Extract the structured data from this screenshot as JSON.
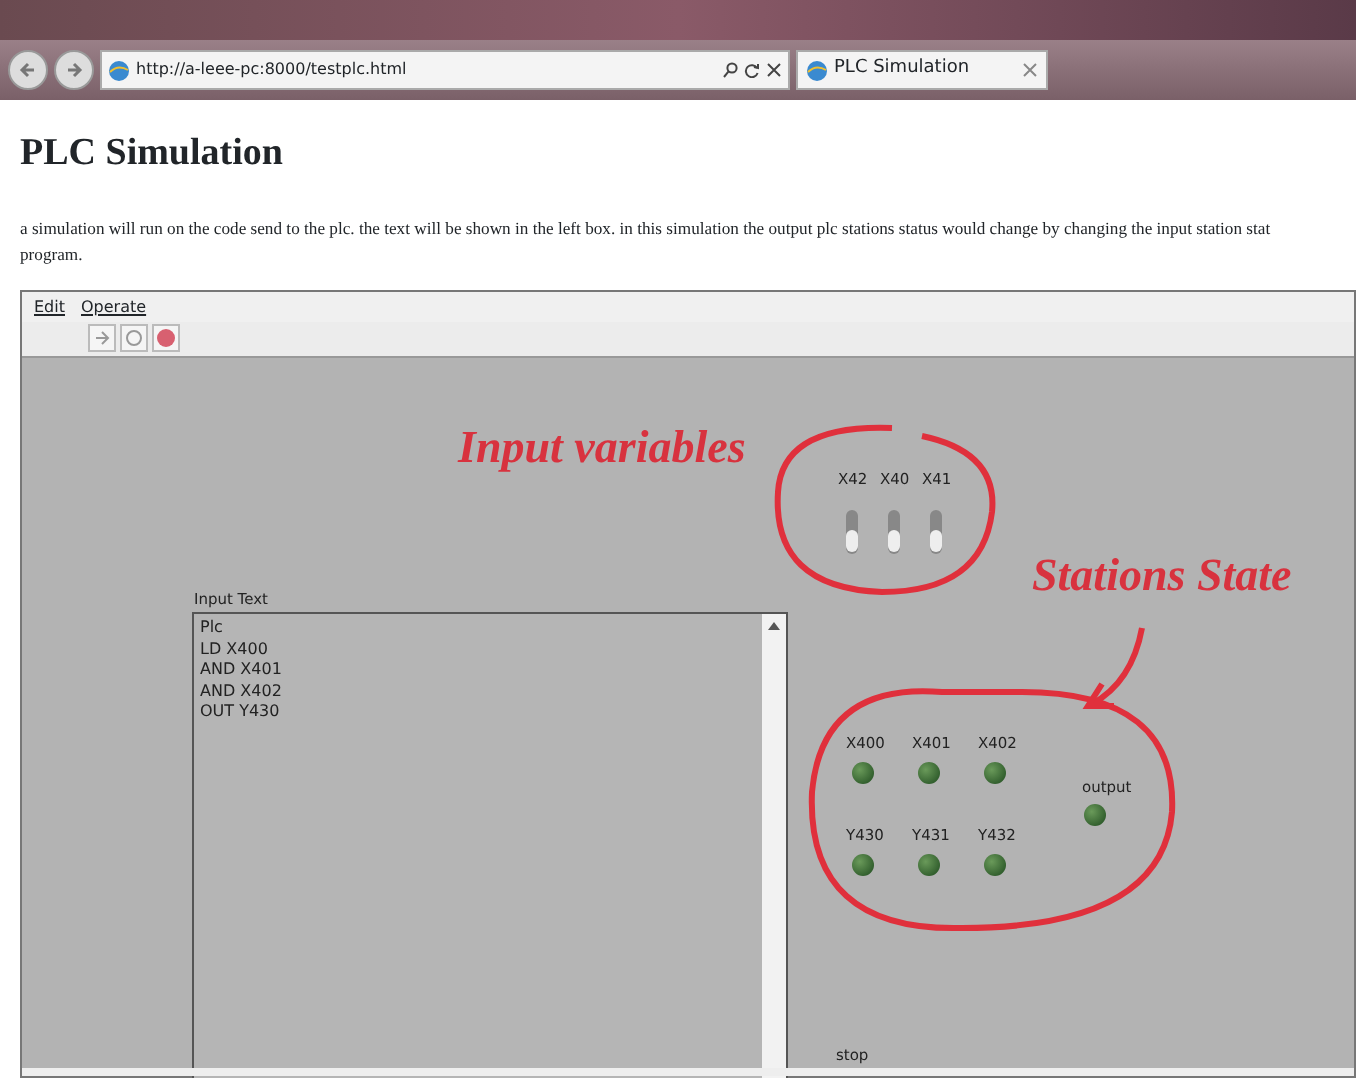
{
  "browser": {
    "url": "http://a-leee-pc:8000/testplc.html",
    "tab_title": "PLC Simulation"
  },
  "page_title": "PLC Simulation",
  "description_lines": [
    "a simulation will run on the code send to the plc. the text will be shown in the left box. in this simulation the output plc stations status would change by changing the input station stat",
    "program."
  ],
  "applet": {
    "menu": [
      "Edit",
      "Operate"
    ],
    "toolbar": [
      {
        "kind": "step"
      },
      {
        "kind": "reset"
      },
      {
        "kind": "stop"
      }
    ],
    "input_text": {
      "label": "Input Text",
      "lines": [
        "Plc",
        "LD X400",
        "AND X401",
        "AND X402",
        "OUT Y430"
      ]
    },
    "switches": [
      {
        "label": "X42",
        "on": false
      },
      {
        "label": "X40",
        "on": false
      },
      {
        "label": "X41",
        "on": false
      }
    ],
    "stations": [
      {
        "label": "X400",
        "on": false
      },
      {
        "label": "X401",
        "on": false
      },
      {
        "label": "X402",
        "on": false
      },
      {
        "label": "Y430",
        "on": false
      },
      {
        "label": "Y431",
        "on": false
      },
      {
        "label": "Y432",
        "on": false
      }
    ],
    "output": {
      "label": "output",
      "on": false
    },
    "status": "stop"
  },
  "annotations": [
    "Input variables",
    "Stations State"
  ]
}
